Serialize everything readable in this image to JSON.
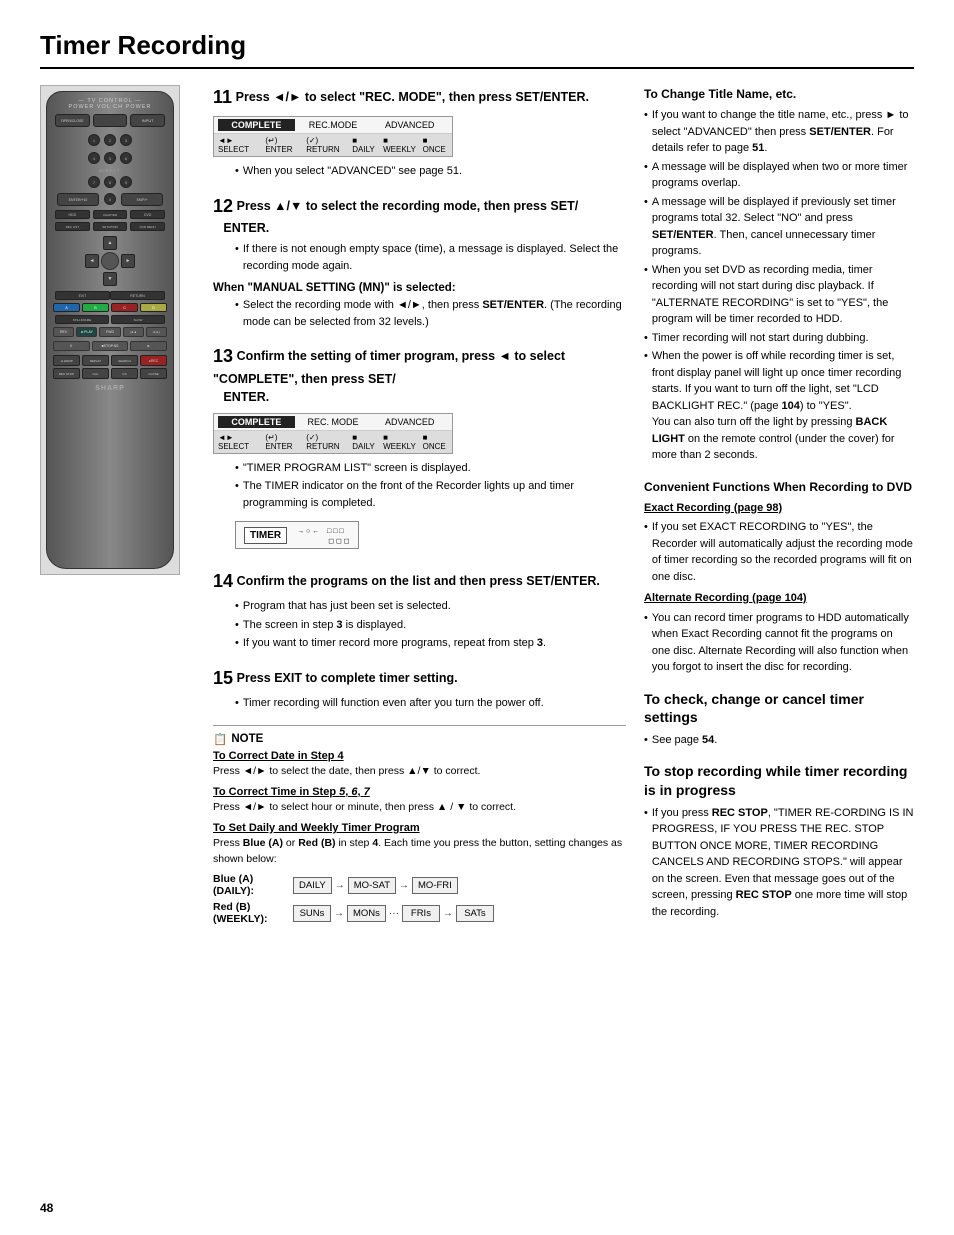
{
  "page": {
    "title": "Timer Recording",
    "page_number": "48"
  },
  "steps": {
    "step11": {
      "num": "11",
      "header": "Press ◄/► to select \"REC. MODE\", then press SET/ENTER.",
      "bullets": [
        "When you select \"ADVANCED\" see page 51."
      ]
    },
    "step12": {
      "num": "12",
      "header": "Press ▲/▼ to select the recording mode, then press SET/ENTER.",
      "bullets": [
        "If there is not enough empty space (time), a message is displayed. Select the recording mode again."
      ]
    },
    "when_selected": {
      "heading": "When \"MANUAL SETTING (MN)\" is selected:",
      "text": "Select the recording mode with ◄/►, then press SET/ENTER. (The recording mode can be selected from 32 levels.)"
    },
    "step13": {
      "num": "13",
      "header": "Confirm the setting of timer program, press ◄ to select \"COMPLETE\", then press SET/ENTER.",
      "bullets": [
        "\"TIMER PROGRAM LIST\" screen is displayed.",
        "The TIMER indicator on the front of the Recorder lights up and timer programming is completed."
      ]
    },
    "step14": {
      "num": "14",
      "header": "Confirm the programs on the list and then press SET/ENTER.",
      "bullets": [
        "Program that has just been set is selected.",
        "The screen in step 3 is displayed.",
        "If you want to timer record more programs, repeat from step 3."
      ]
    },
    "step15": {
      "num": "15",
      "header": "Press EXIT to complete timer setting.",
      "bullets": [
        "Timer recording will function even after you turn the power off."
      ]
    },
    "note": {
      "title": "NOTE",
      "sections": [
        {
          "title": "To Correct Date in Step 4",
          "body": "Press ◄/► to select the date, then press ▲/▼ to correct."
        },
        {
          "title": "To Correct Time in Step 5, 6, 7",
          "body": "Press ◄/► to select hour or minute, then press ▲/▼ to correct."
        },
        {
          "title": "To Set Daily and Weekly Timer Program",
          "body": "Press Blue (A) or Red (B) in step 4. Each time you press the button, setting changes as shown below:"
        }
      ],
      "blue_a_label": "Blue (A) (DAILY):",
      "red_b_label": "Red (B) (WEEKLY):",
      "blue_seq": [
        "DAILY",
        "MO-SAT",
        "MO-FRI"
      ],
      "red_seq": [
        "SUNs",
        "MONs",
        "FRIs",
        "SATs"
      ]
    }
  },
  "right_col": {
    "change_title_section": {
      "title": "To Change Title Name, etc.",
      "bullets": [
        "If you want to change the title name, etc., press ► to select \"ADVANCED\" then press SET/ENTER. For details refer to page 51.",
        "A message will be displayed when two or more timer programs overlap.",
        "A message will be displayed if previously set timer programs total 32. Select \"NO\" and press SET/ENTER. Then, cancel unnecessary timer programs.",
        "When you set DVD as recording media, timer recording will not start during disc playback. If \"ALTERNATE RECORDING\" is set to \"YES\", the program will be timer recorded to HDD.",
        "Timer recording will not start during dubbing.",
        "When the power is off while recording timer is set, front display panel will light up once timer recording starts. If you want to turn off the light, set \"LCD BACKLIGHT REC.\" (page 104) to \"YES\". You can also turn off the light by pressing BACK LIGHT on the remote control (under the cover) for more than 2 seconds."
      ]
    },
    "convenient_section": {
      "title": "Convenient Functions When Recording to DVD",
      "exact_title": "Exact Recording (page 98)",
      "exact_body": "If you set EXACT RECORDING to \"YES\", the Recorder will automatically adjust the recording mode of timer recording so the recorded programs will fit on one disc.",
      "alt_title": "Alternate Recording (page 104)",
      "alt_body": "You can record timer programs to HDD automatically when Exact Recording cannot fit the programs on one disc. Alternate Recording will also function when you forgot to insert the disc for recording."
    },
    "check_section": {
      "title": "To check, change or cancel timer settings",
      "body": "See page 54."
    },
    "stop_section": {
      "title": "To stop recording while timer recording is in progress",
      "body": "If you press REC STOP, \"TIMER RE-CORDING IS IN PROGRESS, IF YOU PRESS THE REC. STOP BUTTON ONCE MORE, TIMER RECORDING CANCELS AND RECORDING STOPS.\" will appear on the screen. Even that message goes out of the screen, pressing REC STOP one more time will stop the recording."
    }
  },
  "screens": {
    "screen1": {
      "top_cells": [
        "COMPLETE",
        "REC.MODE",
        "ADVANCED"
      ],
      "bottom_items": [
        "◄► SELECT",
        "(↵) ENTER",
        "(✓) RETURN",
        "DAILY",
        "WEEKLY",
        "ONCE"
      ]
    },
    "screen2": {
      "top_cells": [
        "COMPLETE",
        "REC.MODE",
        "ADVANCED"
      ],
      "bottom_items": [
        "◄► SELECT",
        "(↵) ENTER",
        "(✓) RETURN",
        "DAILY",
        "WEEKLY",
        "ONCE"
      ]
    }
  },
  "icons": {
    "note_icon": "📋",
    "arrow_right": "→",
    "arrow_left": "←",
    "bullet": "•"
  }
}
